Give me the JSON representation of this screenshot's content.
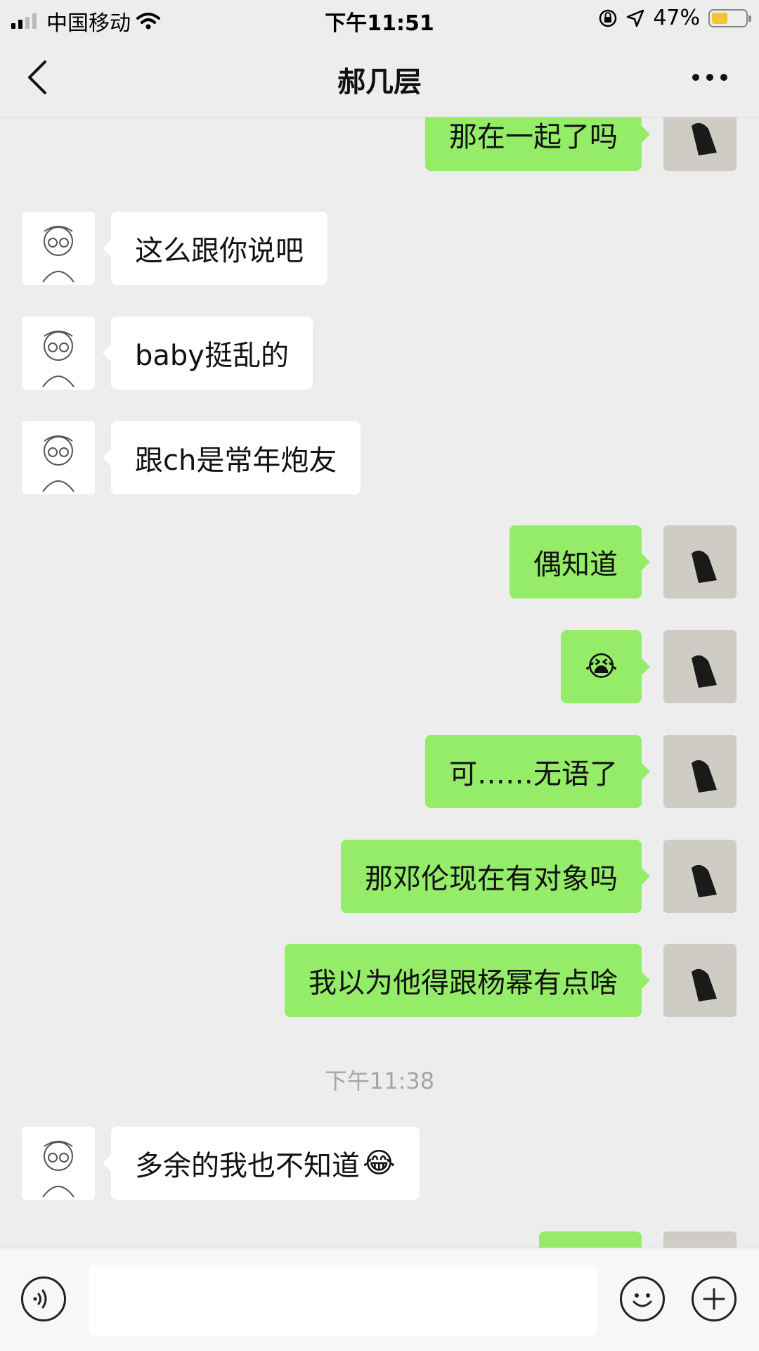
{
  "status_bar": {
    "carrier": "中国移动",
    "time": "下午11:51",
    "battery_percent": "47%",
    "battery_level": 0.47,
    "battery_color": "#f5c431"
  },
  "nav": {
    "title": "郝几层",
    "back_icon": "chevron-left-icon",
    "more_icon": "more-dots-icon"
  },
  "messages": [
    {
      "side": "right",
      "text": "那在一起了吗"
    },
    {
      "side": "left",
      "text": "这么跟你说吧"
    },
    {
      "side": "left",
      "text": "baby挺乱的"
    },
    {
      "side": "left",
      "text": "跟ch是常年炮友"
    },
    {
      "side": "right",
      "text": "偶知道"
    },
    {
      "side": "right",
      "emoji": "😭",
      "emoji_name": "crying-face-emoji"
    },
    {
      "side": "right",
      "text": "可……无语了"
    },
    {
      "side": "right",
      "text": "那邓伦现在有对象吗"
    },
    {
      "side": "right",
      "text": "我以为他得跟杨幂有点啥"
    },
    {
      "time": "下午11:38"
    },
    {
      "side": "left",
      "text": "多余的我也不知道",
      "emoji": "😂",
      "emoji_name": "laughing-crying-emoji"
    },
    {
      "side": "right",
      "text": ""
    }
  ],
  "colors": {
    "background": "#ededed",
    "bubble_self": "#95ec69",
    "bubble_other": "#ffffff",
    "timestamp": "#a6a6a6"
  },
  "input_bar": {
    "voice_icon": "voice-icon",
    "emoji_icon": "emoji-icon",
    "add_icon": "plus-icon",
    "input_value": ""
  }
}
